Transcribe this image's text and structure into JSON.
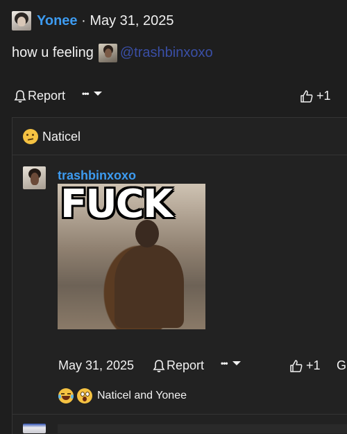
{
  "post": {
    "author": "Yonee",
    "separator": "·",
    "date": "May 31, 2025",
    "text": "how u feeling",
    "mention": "@trashbinxoxo",
    "actions": {
      "report_label": "Report",
      "more_label": "•••",
      "like_count": "+1"
    }
  },
  "reactions_header": {
    "name": "Naticel"
  },
  "reply": {
    "author": "trashbinxoxo",
    "gif_caption": "FUCK",
    "date": "May 31, 2025",
    "actions": {
      "report_label": "Report",
      "more_label": "•••",
      "like_count": "+1",
      "extra_label": "G"
    },
    "reactions_text": "Naticel and Yonee"
  },
  "colors": {
    "background": "#1e1e1e",
    "link_blue": "#3d9bf0",
    "mention_blue": "#3a4fa6"
  },
  "icons": [
    "bell-icon",
    "more-dots-icon",
    "chevron-down-icon",
    "thumbs-up-icon",
    "thinking-emoji",
    "laughing-crying-emoji",
    "astonished-emoji"
  ]
}
